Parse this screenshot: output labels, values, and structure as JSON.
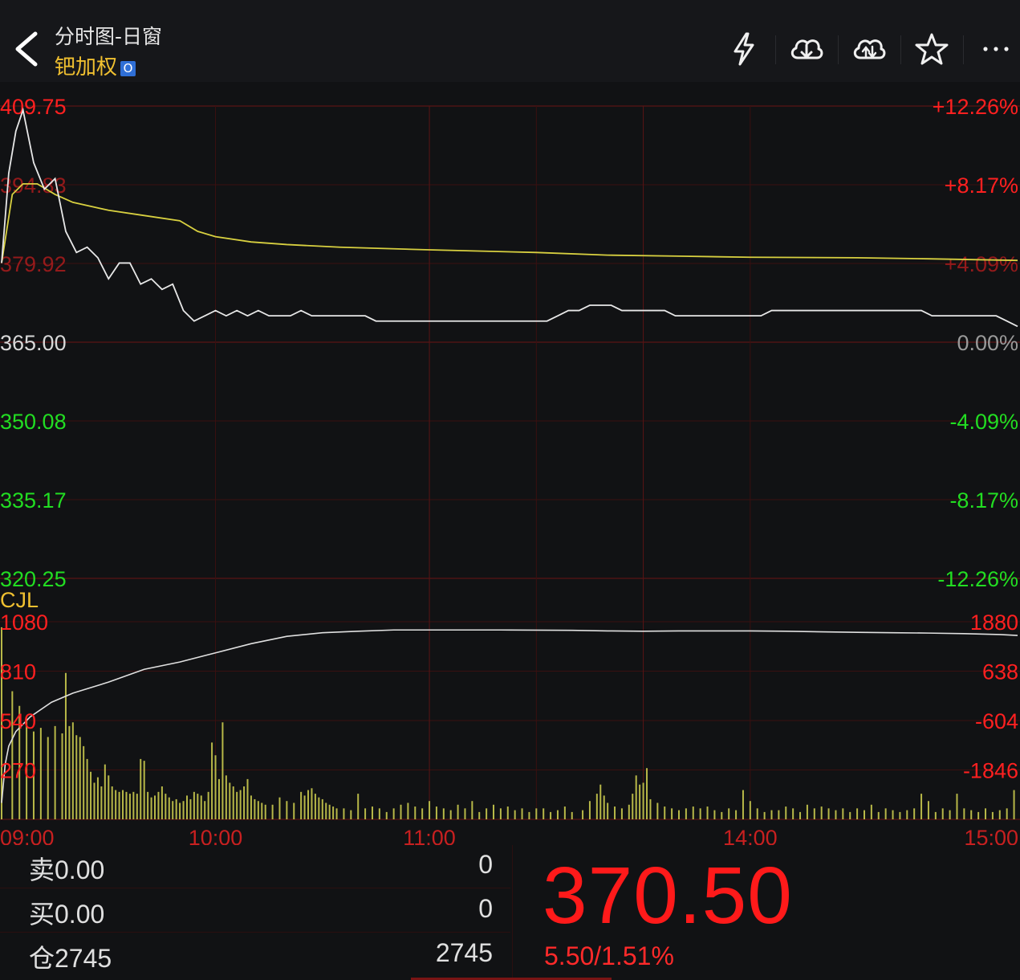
{
  "header": {
    "title": "分时图-日窗",
    "symbol": "钯加权",
    "badge": "O",
    "icons": [
      "lightning-icon",
      "cloud-download-icon",
      "cloud-upload-icon",
      "star-icon",
      "more-icon"
    ]
  },
  "colors": {
    "up": "#ff2020",
    "down": "#22dd22",
    "neutral": "#d8d8d8",
    "price_line": "#e8e8e8",
    "avg_line": "#d8d040",
    "volume_bar": "#b8b848",
    "grid": "#5a1414",
    "grid_faint": "#3a1010"
  },
  "chart_data": {
    "type": "line",
    "title": "",
    "y_left_labels": [
      "409.75",
      "394.83",
      "379.92",
      "365.00",
      "350.08",
      "335.17",
      "320.25"
    ],
    "y_right_labels": [
      "+12.26%",
      "+8.17%",
      "+4.09%",
      "0.00%",
      "-4.09%",
      "-8.17%",
      "-12.26%"
    ],
    "prev_close": 365.0,
    "ylim": [
      320.25,
      409.75
    ],
    "x_tick_labels": [
      "09:00",
      "10:00",
      "11:00",
      "14:00",
      "15:00"
    ],
    "x_tick_positions": [
      0,
      60,
      120,
      210,
      285
    ],
    "total_minutes": 285,
    "series": [
      {
        "key": "price",
        "points": [
          [
            0,
            380
          ],
          [
            2,
            397
          ],
          [
            4,
            405
          ],
          [
            6,
            409
          ],
          [
            9,
            399
          ],
          [
            12,
            394
          ],
          [
            15,
            396
          ],
          [
            18,
            386
          ],
          [
            21,
            382
          ],
          [
            24,
            383
          ],
          [
            27,
            381
          ],
          [
            30,
            377
          ],
          [
            33,
            380
          ],
          [
            36,
            380
          ],
          [
            39,
            376
          ],
          [
            42,
            377
          ],
          [
            45,
            375
          ],
          [
            48,
            376
          ],
          [
            51,
            371
          ],
          [
            54,
            369
          ],
          [
            57,
            370
          ],
          [
            60,
            371
          ],
          [
            63,
            370
          ],
          [
            66,
            371
          ],
          [
            69,
            370
          ],
          [
            72,
            371
          ],
          [
            75,
            370
          ],
          [
            78,
            370
          ],
          [
            81,
            370
          ],
          [
            84,
            371
          ],
          [
            87,
            370
          ],
          [
            90,
            370
          ],
          [
            93,
            370
          ],
          [
            96,
            370
          ],
          [
            99,
            370
          ],
          [
            102,
            370
          ],
          [
            105,
            369
          ],
          [
            108,
            369
          ],
          [
            111,
            369
          ],
          [
            114,
            369
          ],
          [
            117,
            369
          ],
          [
            120,
            369
          ],
          [
            123,
            369
          ],
          [
            126,
            369
          ],
          [
            129,
            369
          ],
          [
            132,
            369
          ],
          [
            135,
            369
          ],
          [
            138,
            369
          ],
          [
            141,
            369
          ],
          [
            144,
            369
          ],
          [
            147,
            369
          ],
          [
            150,
            369
          ],
          [
            153,
            369
          ],
          [
            156,
            370
          ],
          [
            159,
            371
          ],
          [
            162,
            371
          ],
          [
            165,
            372
          ],
          [
            168,
            372
          ],
          [
            171,
            372
          ],
          [
            174,
            371
          ],
          [
            177,
            371
          ],
          [
            180,
            371
          ],
          [
            183,
            371
          ],
          [
            186,
            371
          ],
          [
            189,
            370
          ],
          [
            192,
            370
          ],
          [
            195,
            370
          ],
          [
            198,
            370
          ],
          [
            201,
            370
          ],
          [
            204,
            370
          ],
          [
            207,
            370
          ],
          [
            210,
            370
          ],
          [
            213,
            370
          ],
          [
            216,
            371
          ],
          [
            219,
            371
          ],
          [
            222,
            371
          ],
          [
            225,
            371
          ],
          [
            228,
            371
          ],
          [
            231,
            371
          ],
          [
            234,
            371
          ],
          [
            237,
            371
          ],
          [
            240,
            371
          ],
          [
            243,
            371
          ],
          [
            246,
            371
          ],
          [
            249,
            371
          ],
          [
            252,
            371
          ],
          [
            255,
            371
          ],
          [
            258,
            371
          ],
          [
            261,
            370
          ],
          [
            264,
            370
          ],
          [
            267,
            370
          ],
          [
            270,
            370
          ],
          [
            273,
            370
          ],
          [
            276,
            370
          ],
          [
            279,
            370
          ],
          [
            282,
            369
          ],
          [
            285,
            368
          ]
        ]
      },
      {
        "key": "average",
        "points": [
          [
            0,
            380
          ],
          [
            3,
            393
          ],
          [
            6,
            395
          ],
          [
            10,
            395
          ],
          [
            15,
            393
          ],
          [
            20,
            391.5
          ],
          [
            30,
            390
          ],
          [
            40,
            389
          ],
          [
            50,
            388
          ],
          [
            55,
            386
          ],
          [
            60,
            385
          ],
          [
            70,
            384
          ],
          [
            80,
            383.5
          ],
          [
            95,
            383
          ],
          [
            120,
            382.5
          ],
          [
            150,
            382
          ],
          [
            170,
            381.5
          ],
          [
            190,
            381.3
          ],
          [
            210,
            381.1
          ],
          [
            240,
            381
          ],
          [
            260,
            380.8
          ],
          [
            285,
            380.5
          ]
        ]
      }
    ],
    "volume": {
      "label": "CJL",
      "left_labels": [
        "1080",
        "810",
        "540",
        "270"
      ],
      "right_labels": [
        "1880",
        "638",
        "-604",
        "-1846"
      ],
      "ymax": 1080,
      "bars": [
        [
          0,
          1050
        ],
        [
          3,
          700
        ],
        [
          5,
          620
        ],
        [
          7,
          550
        ],
        [
          9,
          480
        ],
        [
          11,
          500
        ],
        [
          13,
          450
        ],
        [
          15,
          510
        ],
        [
          17,
          470
        ],
        [
          18,
          800
        ],
        [
          19,
          510
        ],
        [
          20,
          530
        ],
        [
          21,
          460
        ],
        [
          22,
          450
        ],
        [
          23,
          400
        ],
        [
          24,
          330
        ],
        [
          25,
          260
        ],
        [
          26,
          200
        ],
        [
          27,
          230
        ],
        [
          28,
          180
        ],
        [
          29,
          300
        ],
        [
          30,
          240
        ],
        [
          31,
          180
        ],
        [
          32,
          160
        ],
        [
          33,
          150
        ],
        [
          34,
          160
        ],
        [
          35,
          150
        ],
        [
          36,
          140
        ],
        [
          37,
          150
        ],
        [
          38,
          140
        ],
        [
          39,
          330
        ],
        [
          40,
          320
        ],
        [
          41,
          150
        ],
        [
          42,
          120
        ],
        [
          43,
          130
        ],
        [
          44,
          150
        ],
        [
          45,
          180
        ],
        [
          46,
          140
        ],
        [
          47,
          120
        ],
        [
          48,
          100
        ],
        [
          49,
          110
        ],
        [
          50,
          90
        ],
        [
          51,
          100
        ],
        [
          52,
          130
        ],
        [
          53,
          110
        ],
        [
          54,
          150
        ],
        [
          55,
          140
        ],
        [
          56,
          130
        ],
        [
          57,
          100
        ],
        [
          58,
          150
        ],
        [
          59,
          420
        ],
        [
          60,
          350
        ],
        [
          61,
          220
        ],
        [
          62,
          530
        ],
        [
          63,
          240
        ],
        [
          64,
          200
        ],
        [
          65,
          180
        ],
        [
          66,
          150
        ],
        [
          67,
          160
        ],
        [
          68,
          180
        ],
        [
          69,
          220
        ],
        [
          70,
          130
        ],
        [
          71,
          110
        ],
        [
          72,
          100
        ],
        [
          73,
          90
        ],
        [
          74,
          80
        ],
        [
          76,
          80
        ],
        [
          78,
          120
        ],
        [
          80,
          100
        ],
        [
          82,
          90
        ],
        [
          84,
          150
        ],
        [
          85,
          130
        ],
        [
          86,
          160
        ],
        [
          87,
          170
        ],
        [
          88,
          140
        ],
        [
          89,
          120
        ],
        [
          90,
          110
        ],
        [
          91,
          90
        ],
        [
          92,
          80
        ],
        [
          93,
          70
        ],
        [
          94,
          60
        ],
        [
          96,
          60
        ],
        [
          98,
          50
        ],
        [
          100,
          140
        ],
        [
          102,
          60
        ],
        [
          104,
          70
        ],
        [
          106,
          60
        ],
        [
          108,
          40
        ],
        [
          110,
          60
        ],
        [
          112,
          80
        ],
        [
          114,
          90
        ],
        [
          116,
          70
        ],
        [
          118,
          60
        ],
        [
          120,
          100
        ],
        [
          122,
          70
        ],
        [
          124,
          60
        ],
        [
          126,
          50
        ],
        [
          128,
          80
        ],
        [
          130,
          60
        ],
        [
          132,
          100
        ],
        [
          134,
          40
        ],
        [
          136,
          60
        ],
        [
          138,
          80
        ],
        [
          140,
          60
        ],
        [
          142,
          70
        ],
        [
          144,
          50
        ],
        [
          146,
          60
        ],
        [
          148,
          40
        ],
        [
          150,
          60
        ],
        [
          152,
          60
        ],
        [
          154,
          40
        ],
        [
          156,
          50
        ],
        [
          158,
          70
        ],
        [
          160,
          40
        ],
        [
          163,
          50
        ],
        [
          165,
          100
        ],
        [
          167,
          140
        ],
        [
          168,
          190
        ],
        [
          169,
          130
        ],
        [
          170,
          90
        ],
        [
          172,
          70
        ],
        [
          174,
          60
        ],
        [
          176,
          80
        ],
        [
          177,
          140
        ],
        [
          178,
          240
        ],
        [
          179,
          190
        ],
        [
          180,
          200
        ],
        [
          181,
          280
        ],
        [
          182,
          110
        ],
        [
          184,
          90
        ],
        [
          186,
          70
        ],
        [
          188,
          60
        ],
        [
          190,
          50
        ],
        [
          192,
          60
        ],
        [
          194,
          70
        ],
        [
          196,
          60
        ],
        [
          198,
          70
        ],
        [
          200,
          50
        ],
        [
          202,
          40
        ],
        [
          204,
          60
        ],
        [
          206,
          50
        ],
        [
          208,
          160
        ],
        [
          210,
          100
        ],
        [
          212,
          60
        ],
        [
          214,
          40
        ],
        [
          216,
          50
        ],
        [
          218,
          50
        ],
        [
          220,
          70
        ],
        [
          222,
          60
        ],
        [
          224,
          40
        ],
        [
          226,
          80
        ],
        [
          228,
          60
        ],
        [
          230,
          70
        ],
        [
          232,
          60
        ],
        [
          234,
          50
        ],
        [
          236,
          60
        ],
        [
          238,
          40
        ],
        [
          240,
          60
        ],
        [
          242,
          50
        ],
        [
          244,
          80
        ],
        [
          246,
          40
        ],
        [
          248,
          60
        ],
        [
          250,
          50
        ],
        [
          252,
          40
        ],
        [
          254,
          50
        ],
        [
          256,
          60
        ],
        [
          258,
          140
        ],
        [
          260,
          100
        ],
        [
          262,
          40
        ],
        [
          264,
          60
        ],
        [
          266,
          50
        ],
        [
          268,
          140
        ],
        [
          270,
          60
        ],
        [
          272,
          50
        ],
        [
          274,
          40
        ],
        [
          276,
          60
        ],
        [
          278,
          40
        ],
        [
          280,
          50
        ],
        [
          282,
          60
        ],
        [
          284,
          160
        ]
      ]
    },
    "volume_line": {
      "points": [
        [
          0,
          90
        ],
        [
          1,
          300
        ],
        [
          2,
          400
        ],
        [
          4,
          480
        ],
        [
          8,
          560
        ],
        [
          14,
          640
        ],
        [
          20,
          690
        ],
        [
          30,
          750
        ],
        [
          40,
          820
        ],
        [
          50,
          860
        ],
        [
          60,
          910
        ],
        [
          70,
          960
        ],
        [
          80,
          1000
        ],
        [
          90,
          1020
        ],
        [
          100,
          1028
        ],
        [
          110,
          1035
        ],
        [
          120,
          1035
        ],
        [
          140,
          1035
        ],
        [
          160,
          1033
        ],
        [
          170,
          1030
        ],
        [
          180,
          1028
        ],
        [
          190,
          1030
        ],
        [
          200,
          1030
        ],
        [
          210,
          1030
        ],
        [
          220,
          1028
        ],
        [
          230,
          1025
        ],
        [
          240,
          1022
        ],
        [
          250,
          1020
        ],
        [
          260,
          1018
        ],
        [
          270,
          1015
        ],
        [
          280,
          1010
        ],
        [
          285,
          1005
        ]
      ],
      "ymax": 1080
    }
  },
  "quote": {
    "sell_label": "卖0.00",
    "sell_qty": "0",
    "buy_label": "买0.00",
    "buy_qty": "0",
    "oi_label": "仓2745",
    "oi_qty": "2745",
    "last_price": "370.50",
    "change": "5.50/1.51%"
  }
}
